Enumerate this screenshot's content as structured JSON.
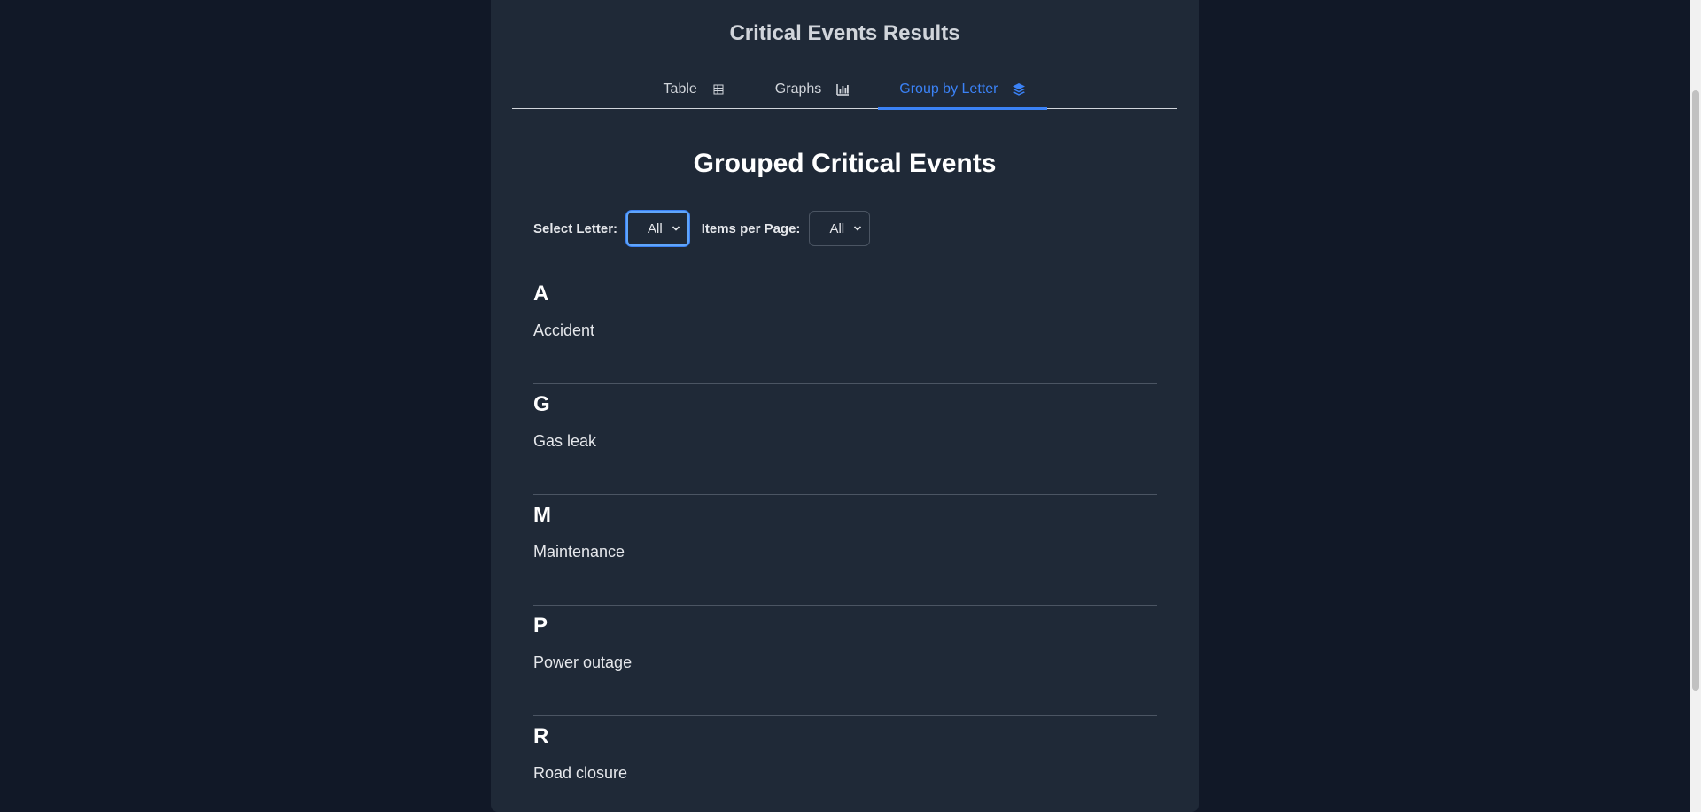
{
  "app": {
    "title": "Critical Events Results"
  },
  "tabs": [
    {
      "label": "Table",
      "icon": "table-icon",
      "active": false
    },
    {
      "label": "Graphs",
      "icon": "bar-chart-icon",
      "active": false
    },
    {
      "label": "Group by Letter",
      "icon": "layers-icon",
      "active": true
    }
  ],
  "section": {
    "title": "Grouped Critical Events"
  },
  "controls": {
    "letter_label": "Select Letter:",
    "letter_value": "All",
    "per_page_label": "Items per Page:",
    "per_page_value": "All"
  },
  "groups": [
    {
      "letter": "A",
      "items": [
        "Accident"
      ]
    },
    {
      "letter": "G",
      "items": [
        "Gas leak"
      ]
    },
    {
      "letter": "M",
      "items": [
        "Maintenance"
      ]
    },
    {
      "letter": "P",
      "items": [
        "Power outage"
      ]
    },
    {
      "letter": "R",
      "items": [
        "Road closure"
      ]
    }
  ],
  "colors": {
    "background": "#111827",
    "panel": "#1f2937",
    "accent": "#3b82f6"
  }
}
